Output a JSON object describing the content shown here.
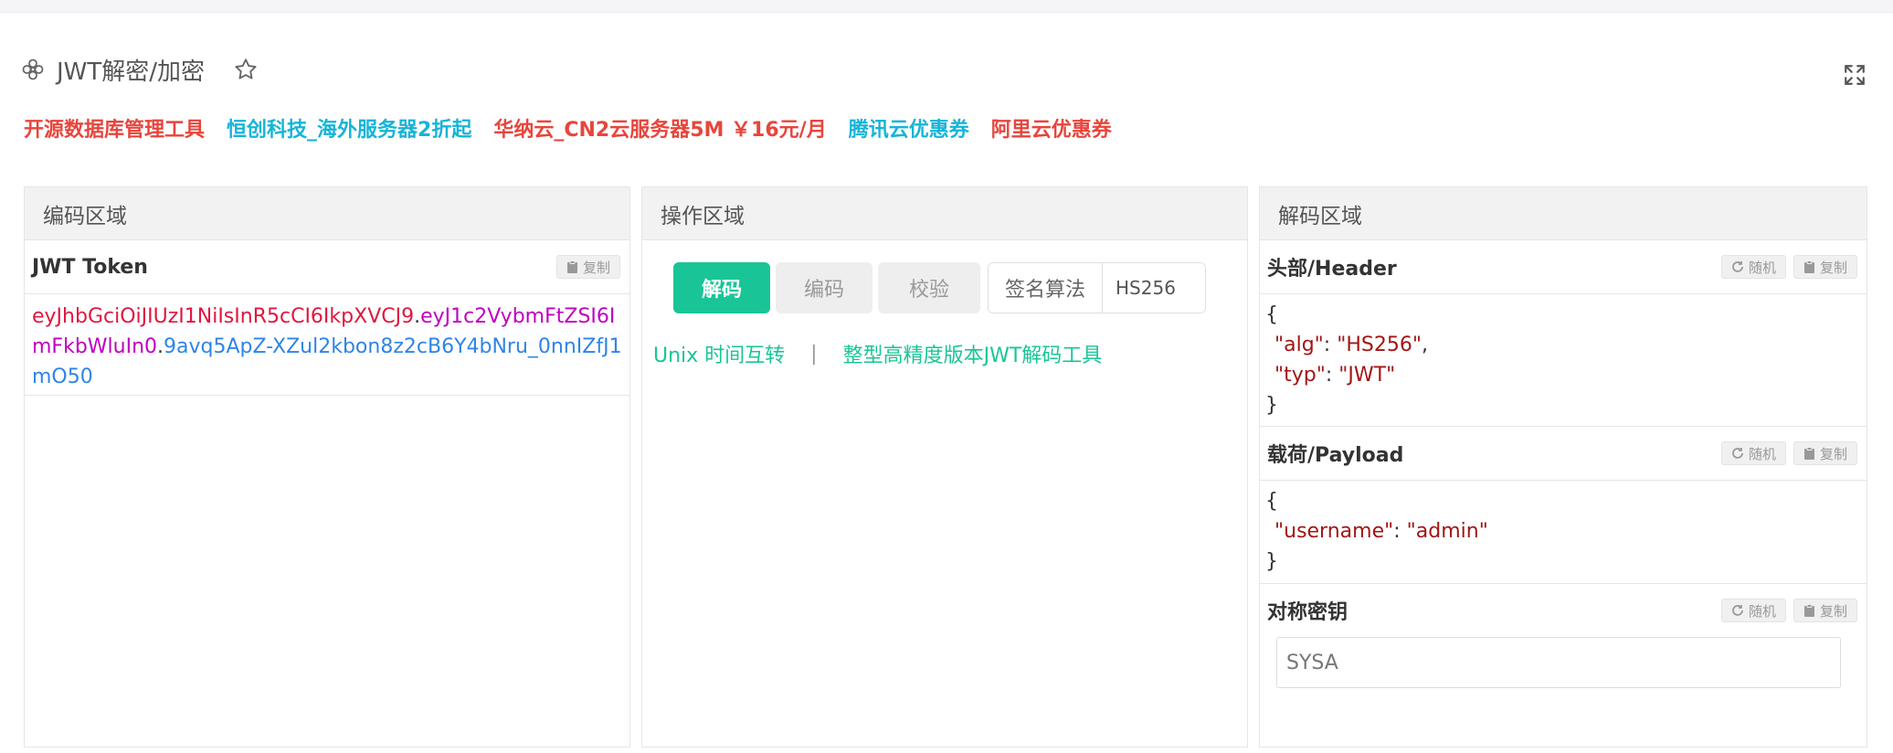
{
  "title": "JWT解密/加密",
  "promos": [
    {
      "label": "开源数据库管理工具",
      "color": "#e8453c"
    },
    {
      "label": "恒创科技_海外服务器2折起",
      "color": "#17b4d8"
    },
    {
      "label": "华纳云_CN2云服务器5M ￥16元/月",
      "color": "#e8453c"
    },
    {
      "label": "腾讯云优惠券",
      "color": "#17b4d8"
    },
    {
      "label": "阿里云优惠券",
      "color": "#e8453c"
    }
  ],
  "encode_panel": {
    "header": "编码区域",
    "token_label": "JWT Token",
    "copy_label": "复制",
    "token": {
      "header_part": "eyJhbGciOiJIUzI1NiIsInR5cCI6IkpXVCJ9",
      "payload_part": "eyJ1c2VybmFtZSI6ImFkbWluIn0",
      "signature_part": "9avq5ApZ-XZul2kbon8z2cB6Y4bNru_0nnIZfJ1mO50",
      "dot": "."
    }
  },
  "op_panel": {
    "header": "操作区域",
    "decode_label": "解码",
    "encode_label": "编码",
    "verify_label": "校验",
    "algo_label": "签名算法",
    "algo_value": "HS256",
    "link_unix": "Unix 时间互转",
    "separator": "|",
    "link_precision": "整型高精度版本JWT解码工具"
  },
  "decode_panel": {
    "header": "解码区域",
    "random_label": "随机",
    "copy_label": "复制",
    "header_section": {
      "label": "头部/Header",
      "open": "{",
      "close": "}",
      "lines": [
        {
          "key": "\"alg\"",
          "colon": ": ",
          "value": "\"HS256\"",
          "comma": ","
        },
        {
          "key": "\"typ\"",
          "colon": ": ",
          "value": "\"JWT\"",
          "comma": ""
        }
      ]
    },
    "payload_section": {
      "label": "载荷/Payload",
      "open": "{",
      "close": "}",
      "lines": [
        {
          "key": "\"username\"",
          "colon": ": ",
          "value": "\"admin\"",
          "comma": ""
        }
      ]
    },
    "secret_section": {
      "label": "对称密钥",
      "value": "SYSA"
    }
  }
}
